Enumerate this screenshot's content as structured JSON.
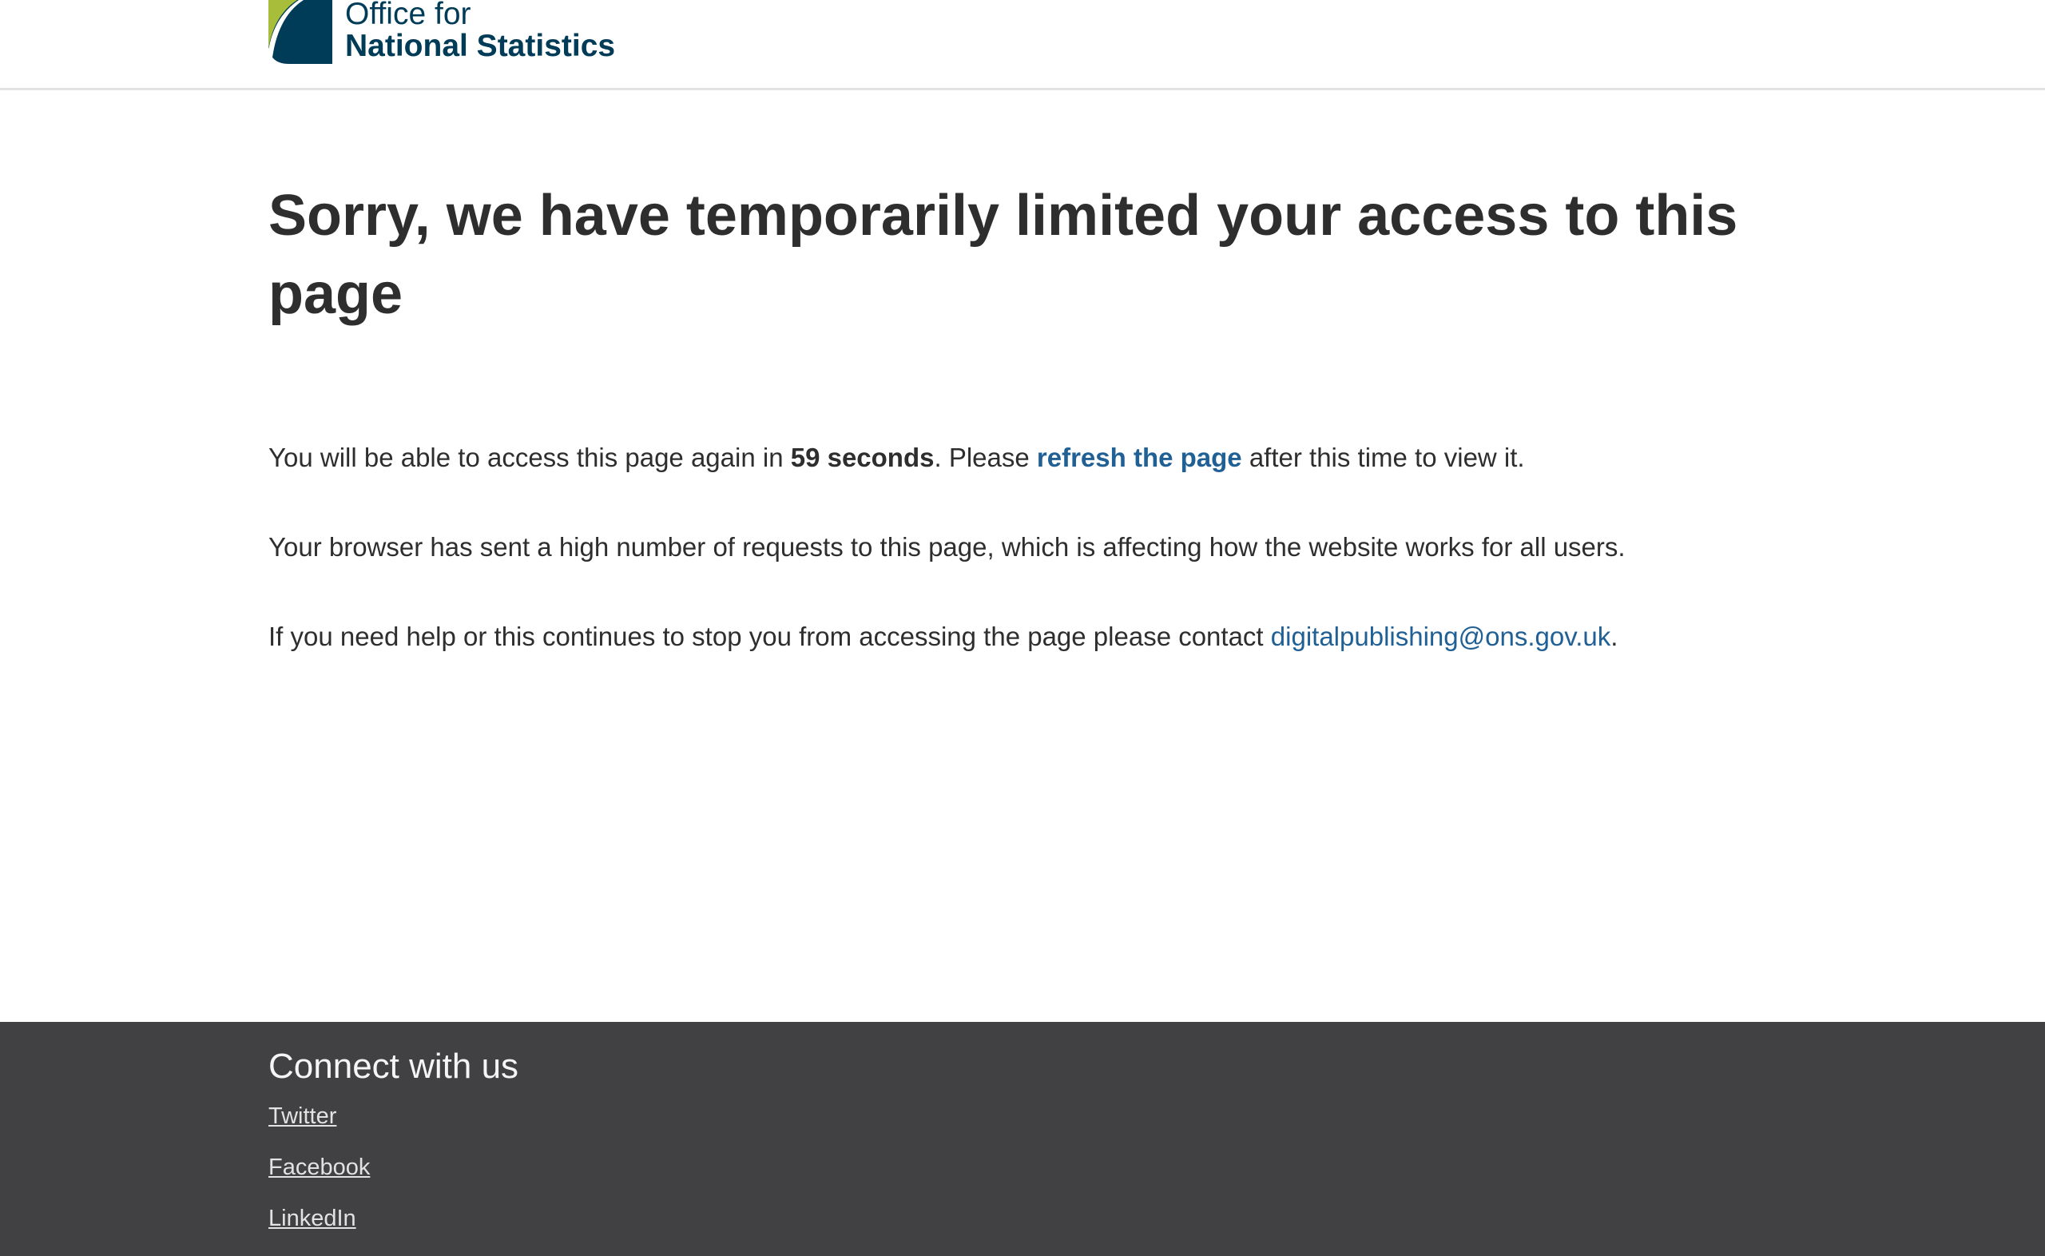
{
  "header": {
    "logo_line1": "Office for",
    "logo_line2": "National Statistics"
  },
  "main": {
    "title": "Sorry, we have temporarily limited your access to this page",
    "p1": {
      "before": "You will be able to access this page again in ",
      "countdown": "59 seconds",
      "middle": ". Please ",
      "link": "refresh the page",
      "after": " after this time to view it."
    },
    "p2": "Your browser has sent a high number of requests to this page, which is affecting how the website works for all users.",
    "p3": {
      "before": "If you need help or this continues to stop you from accessing the page please contact ",
      "email": "digitalpublishing@ons.gov.uk",
      "after": "."
    }
  },
  "footer": {
    "heading": "Connect with us",
    "links": [
      "Twitter",
      "Facebook",
      "LinkedIn"
    ]
  },
  "colors": {
    "brand_dark": "#003c57",
    "brand_green": "#a8bd3a",
    "link": "#206095",
    "footer_bg": "#414042",
    "text": "#2e2e2e"
  },
  "icons": {
    "logo": "ons-logo-icon"
  }
}
